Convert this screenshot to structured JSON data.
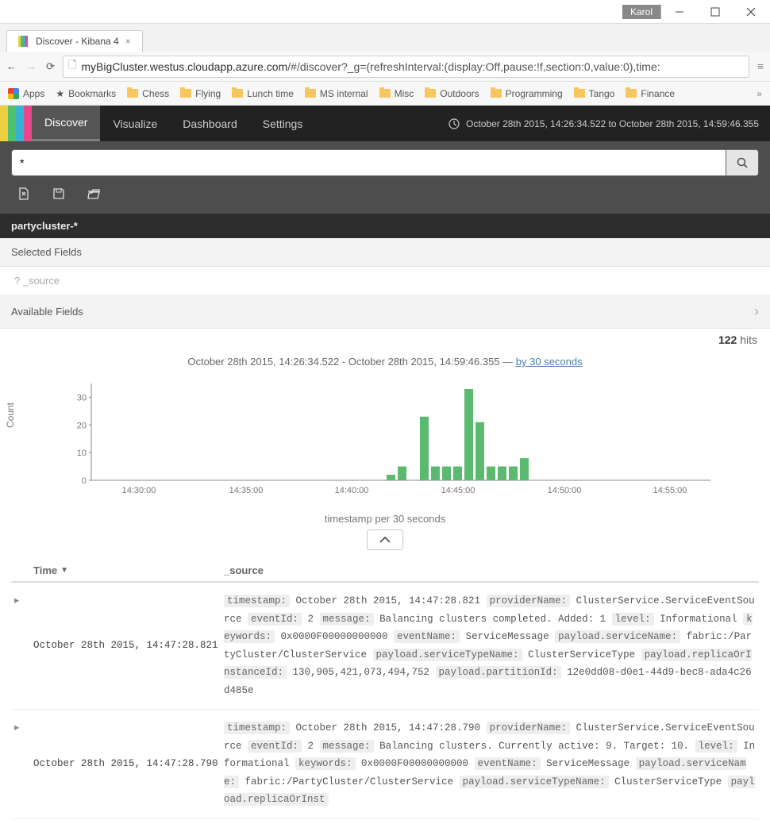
{
  "window": {
    "profile": "Karol"
  },
  "tab": {
    "title": "Discover - Kibana 4"
  },
  "toolbar": {
    "url_prefix": "myBigCluster.westus.cloudapp.azure.com",
    "url_path": "/#/discover?_g=(refreshInterval:(display:Off,pause:!f,section:0,value:0),time:"
  },
  "bookmarks": {
    "apps": "Apps",
    "items": [
      "Bookmarks",
      "Chess",
      "Flying",
      "Lunch time",
      "MS internal",
      "Misc",
      "Outdoors",
      "Programming",
      "Tango",
      "Finance"
    ]
  },
  "nav": {
    "items": [
      "Discover",
      "Visualize",
      "Dashboard",
      "Settings"
    ],
    "active": 0,
    "timerange": "October 28th 2015, 14:26:34.522 to October 28th 2015, 14:59:46.355"
  },
  "search": {
    "query": "*"
  },
  "index_pattern": "partycluster-*",
  "fields": {
    "selected_label": "Selected Fields",
    "source_hint": "? _source",
    "available_label": "Available Fields"
  },
  "hits": {
    "count": "122",
    "suffix": "hits"
  },
  "histogram": {
    "title_text": "October 28th 2015, 14:26:34.522 - October 28th 2015, 14:59:46.355 — ",
    "interval_link": "by 30 seconds",
    "ylabel": "Count",
    "xlabel": "timestamp per 30 seconds"
  },
  "chart_data": {
    "type": "bar",
    "title": "October 28th 2015, 14:26:34.522 - October 28th 2015, 14:59:46.355",
    "xlabel": "timestamp per 30 seconds",
    "ylabel": "Count",
    "ylim": [
      0,
      35
    ],
    "y_ticks": [
      0,
      10,
      20,
      30
    ],
    "x_ticks": [
      "14:30:00",
      "14:35:00",
      "14:40:00",
      "14:45:00",
      "14:50:00",
      "14:55:00"
    ],
    "x_tick_offsets": [
      60,
      195,
      328,
      462,
      596,
      729
    ],
    "categories": [
      "14:41:30",
      "14:42:00",
      "14:42:30",
      "14:43:00",
      "14:43:30",
      "14:44:00",
      "14:44:30",
      "14:45:00",
      "14:45:30",
      "14:46:00",
      "14:46:30",
      "14:47:00",
      "14:47:30"
    ],
    "bar_offsets": [
      372,
      386,
      400,
      414,
      428,
      442,
      456,
      470,
      484,
      498,
      512,
      526,
      540
    ],
    "values": [
      2,
      5,
      0,
      23,
      5,
      5,
      5,
      33,
      21,
      5,
      5,
      5,
      8
    ]
  },
  "table": {
    "headers": {
      "time": "Time",
      "source": "_source"
    },
    "rows": [
      {
        "time": "October 28th 2015, 14:47:28.821",
        "kv": [
          [
            "timestamp:",
            "October 28th 2015, 14:47:28.821"
          ],
          [
            "providerName:",
            "ClusterService.ServiceEventSource"
          ],
          [
            "eventId:",
            "2"
          ],
          [
            "message:",
            "Balancing clusters completed. Added: 1"
          ],
          [
            "level:",
            "Informational"
          ],
          [
            "keywords:",
            "0x0000F00000000000"
          ],
          [
            "eventName:",
            "ServiceMessage"
          ],
          [
            "payload.serviceName:",
            "fabric:/PartyCluster/ClusterService"
          ],
          [
            "payload.serviceTypeName:",
            "ClusterServiceType"
          ],
          [
            "payload.replicaOrInstanceId:",
            "130,905,421,073,494,752"
          ],
          [
            "payload.partitionId:",
            "12e0dd08-d0e1-44d9-bec8-ada4c26d485e"
          ]
        ]
      },
      {
        "time": "October 28th 2015, 14:47:28.790",
        "kv": [
          [
            "timestamp:",
            "October 28th 2015, 14:47:28.790"
          ],
          [
            "providerName:",
            "ClusterService.ServiceEventSource"
          ],
          [
            "eventId:",
            "2"
          ],
          [
            "message:",
            "Balancing clusters. Currently active: 9. Target: 10."
          ],
          [
            "level:",
            "Informational"
          ],
          [
            "keywords:",
            "0x0000F00000000000"
          ],
          [
            "eventName:",
            "ServiceMessage"
          ],
          [
            "payload.serviceName:",
            "fabric:/PartyCluster/ClusterService"
          ],
          [
            "payload.serviceTypeName:",
            "ClusterServiceType"
          ],
          [
            "payload.replicaOrInst"
          ]
        ]
      }
    ]
  }
}
